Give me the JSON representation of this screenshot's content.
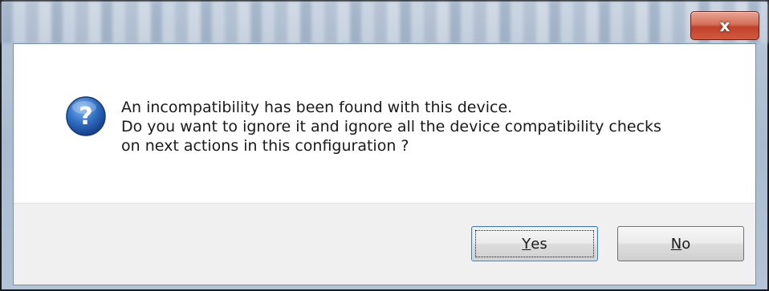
{
  "dialog": {
    "close_label": "x",
    "message_lines": [
      "An incompatibility has been found with this device.",
      "Do you want to ignore it and ignore all the device compatibility checks",
      "on next actions in this configuration ?"
    ],
    "icon": "question-icon"
  },
  "buttons": {
    "yes": {
      "mnemonic": "Y",
      "rest": "es"
    },
    "no": {
      "mnemonic": "N",
      "rest": "o"
    }
  },
  "colors": {
    "close_button": "#c2412a",
    "icon_blue": "#1f5fb0",
    "default_button_border": "#3c7fb1"
  }
}
